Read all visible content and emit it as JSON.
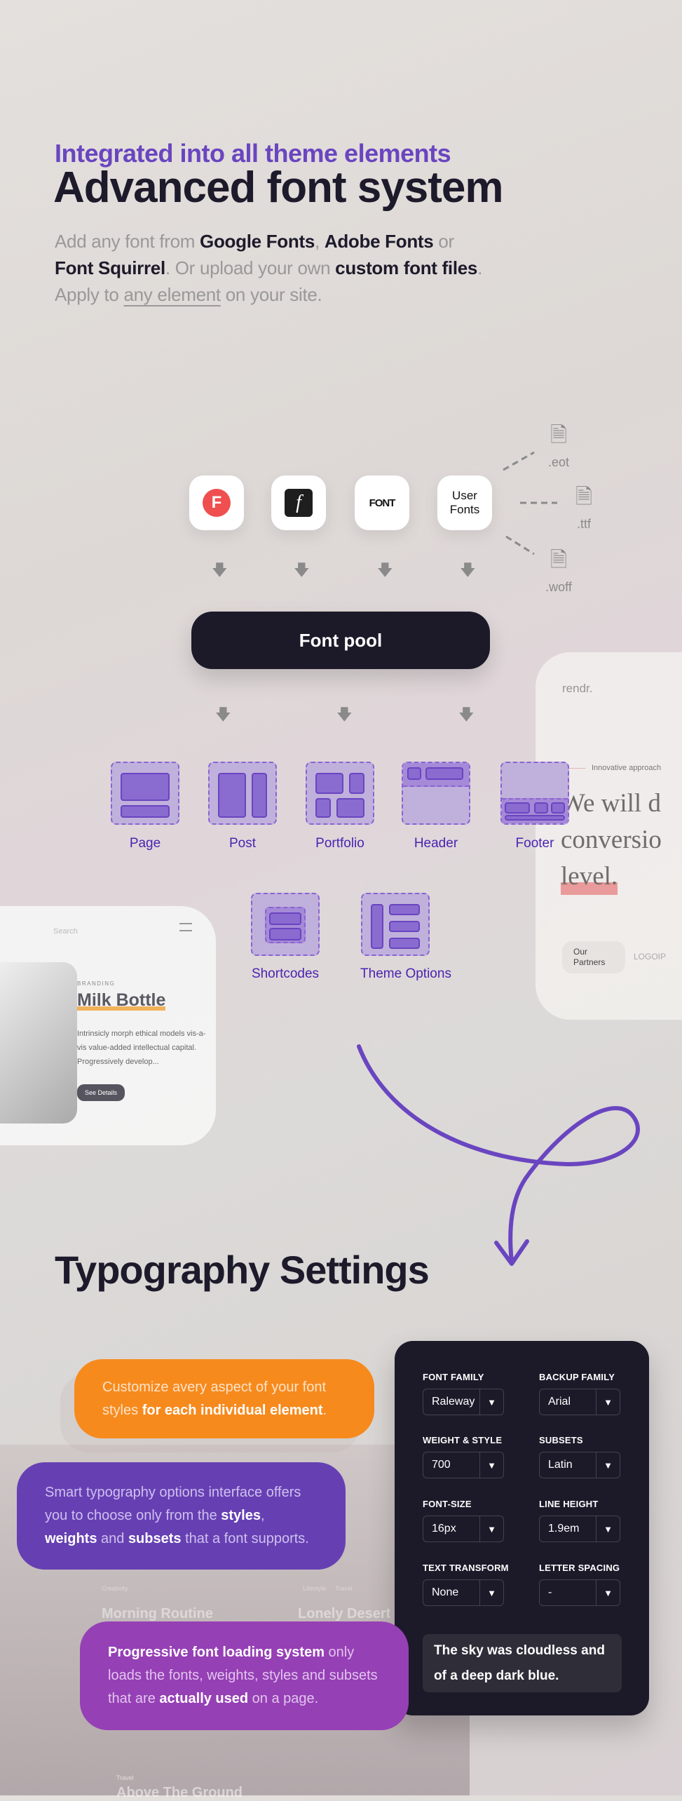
{
  "hero": {
    "subtitle": "Integrated into all theme elements",
    "title": "Advanced font system",
    "intro": [
      "Add any font from ",
      "Google Fonts",
      ", ",
      "Adobe Fonts",
      " or ",
      "Font Squirrel",
      ". Or upload your own ",
      "custom font files",
      ". Apply to ",
      "any element",
      " on your site."
    ]
  },
  "sources": [
    {
      "name": "Fontyou",
      "glyph": "F",
      "color": "#ef4f4f"
    },
    {
      "name": "Adobe Fonts",
      "glyph": "f",
      "color": "#1e1e1e"
    },
    {
      "name": "Font Squirrel",
      "glyph": "FONT"
    },
    {
      "name": "User Fonts",
      "glyph": "User Fonts"
    }
  ],
  "files": [
    ".eot",
    ".ttf",
    ".woff"
  ],
  "pool": "Font pool",
  "elements": [
    "Page",
    "Post",
    "Portfolio",
    "Header",
    "Footer",
    "Shortcodes",
    "Theme Options"
  ],
  "mock_right": {
    "logo": "rendr.",
    "eyebrow": "Innovative approach",
    "headline": [
      "We will d",
      "conversio",
      "level."
    ],
    "partners": "Our Partners",
    "logo_text": "LOGOIP"
  },
  "mock_left": {
    "search": "Search",
    "category": "BRANDING",
    "title": "Milk Bottle",
    "text": "Intrinsicly morph ethical models vis-a-vis value-added intellectual capital. Progressively develop...",
    "button": "See Details"
  },
  "mock_bottom": {
    "cards": [
      "Morning Routine",
      "Lonely Desert",
      "Above The Ground"
    ],
    "tags": [
      "Creativity",
      "Lifestyle",
      "Travel",
      "Travel"
    ]
  },
  "typography": {
    "title": "Typography Settings",
    "bubbles": [
      {
        "color": "#f78a1d",
        "parts": [
          "Customize avery aspect of your font styles ",
          "for each individual element",
          "."
        ]
      },
      {
        "color": "#6640b3",
        "parts": [
          "Smart typography options interface offers you to choose only from the ",
          "styles",
          ", ",
          "weights",
          " and ",
          "subsets",
          " that a font supports."
        ]
      },
      {
        "color": "#9640b5",
        "parts": [
          "Progressive font loading system",
          " only loads the fonts, weights, styles and subsets that are ",
          "actually used",
          " on a page."
        ]
      }
    ],
    "settings": [
      {
        "label": "FONT FAMILY",
        "value": "Raleway"
      },
      {
        "label": "BACKUP FAMILY",
        "value": "Arial"
      },
      {
        "label": "WEIGHT & STYLE",
        "value": "700"
      },
      {
        "label": "SUBSETS",
        "value": "Latin"
      },
      {
        "label": "FONT-SIZE",
        "value": "16px"
      },
      {
        "label": "LINE HEIGHT",
        "value": "1.9em"
      },
      {
        "label": "TEXT TRANSFORM",
        "value": "None"
      },
      {
        "label": "LETTER SPACING",
        "value": "-"
      }
    ],
    "sample": "The sky was cloudless and of a deep dark blue."
  }
}
